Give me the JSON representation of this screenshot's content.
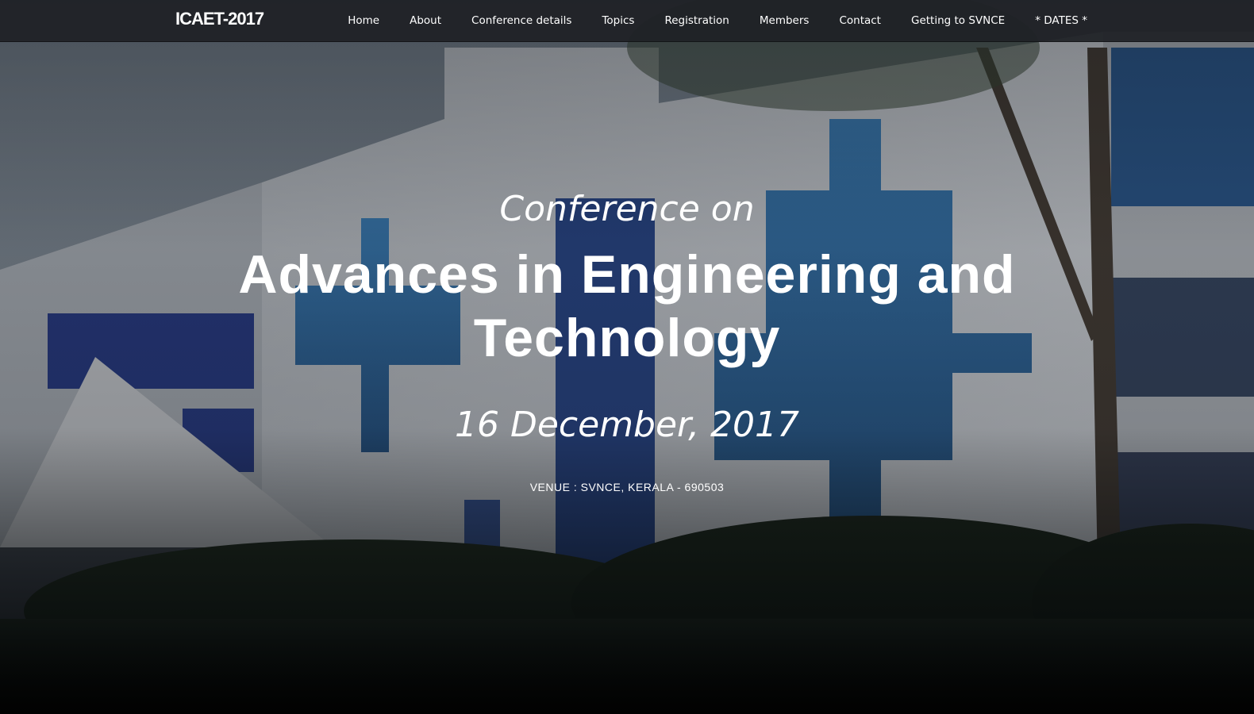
{
  "brand": "ICAET-2017",
  "nav": {
    "items": [
      {
        "label": "Home"
      },
      {
        "label": "About"
      },
      {
        "label": "Conference details"
      },
      {
        "label": "Topics"
      },
      {
        "label": "Registration"
      },
      {
        "label": "Members"
      },
      {
        "label": "Contact"
      },
      {
        "label": "Getting to SVNCE"
      },
      {
        "label": "* DATES *"
      }
    ]
  },
  "hero": {
    "pre_title": "Conference on",
    "title": "Advances in Engineering and Technology",
    "date": "16 December, 2017",
    "venue": "VENUE : SVNCE, KERALA - 690503"
  },
  "colors": {
    "navbar_bg": "#1e2125",
    "text": "#ffffff",
    "window_blue": "#2f6da8"
  }
}
